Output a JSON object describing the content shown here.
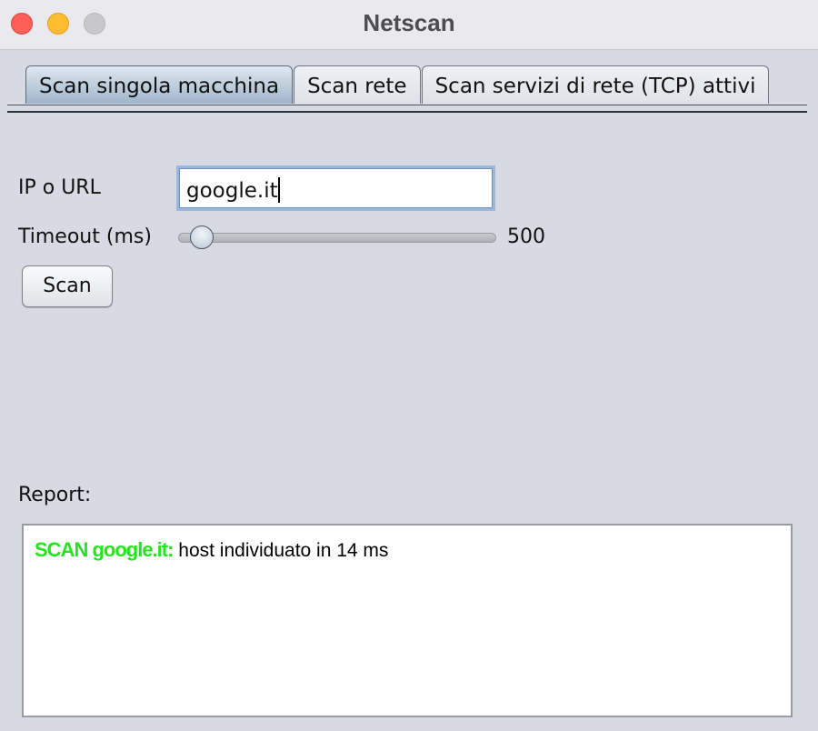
{
  "window": {
    "title": "Netscan"
  },
  "tabs": [
    {
      "label": "Scan singola macchina",
      "active": true
    },
    {
      "label": "Scan rete",
      "active": false
    },
    {
      "label": "Scan servizi di rete (TCP) attivi",
      "active": false
    }
  ],
  "form": {
    "ip_label": "IP o URL",
    "ip_value": "google.it",
    "timeout_label": "Timeout (ms)",
    "timeout_value": "500",
    "scan_button": "Scan"
  },
  "report": {
    "label": "Report:",
    "prefix": "SCAN google.it:",
    "message": " host individuato in 14 ms",
    "prefix_color": "#22e61b"
  }
}
